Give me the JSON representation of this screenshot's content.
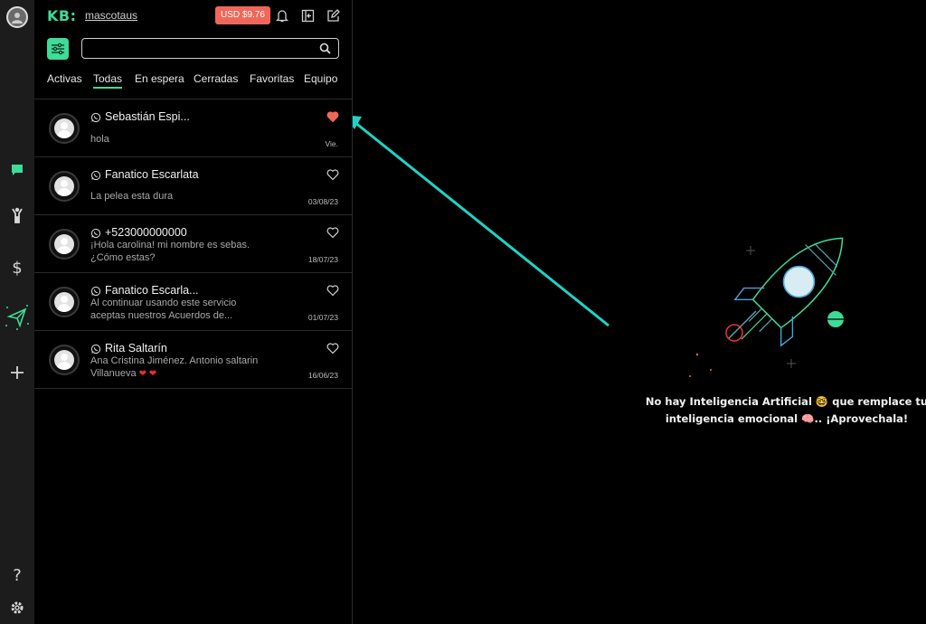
{
  "header": {
    "logo": "KB:",
    "username": "mascotaus",
    "balance": "USD $9.76"
  },
  "search": {
    "value": "",
    "placeholder": ""
  },
  "tabs": [
    {
      "label": "Activas"
    },
    {
      "label": "Todas",
      "active": true
    },
    {
      "label": "En espera"
    },
    {
      "label": "Cerradas"
    },
    {
      "label": "Favoritas"
    },
    {
      "label": "Equipo"
    }
  ],
  "conversations": [
    {
      "name": "Sebastián Espi...",
      "line1": "hola",
      "line2": "",
      "date": "Vie.",
      "favorite": true
    },
    {
      "name": "Fanatico Escarlata",
      "line1": "La pelea esta dura",
      "line2": "",
      "date": "03/08/23",
      "favorite": false
    },
    {
      "name": "+523000000000",
      "line1": "¡Hola carolina! mi nombre es sebas.",
      "line2": "¿Cómo estas?",
      "date": "18/07/23",
      "favorite": false
    },
    {
      "name": "Fanatico Escarla...",
      "line1": "Al continuar usando este servicio",
      "line2": "aceptas nuestros Acuerdos de...",
      "date": "01/07/23",
      "favorite": false
    },
    {
      "name": "Rita Saltarín",
      "line1": "Ana Cristina Jiménez. Antonio saltarin",
      "line2": "Villanueva",
      "date": "16/06/23",
      "favorite": false
    }
  ],
  "main": {
    "tagline_line1": "No hay Inteligencia Artificial 🤓 que remplace tu",
    "tagline_line2": "inteligencia emocional 🧠.. ¡Aprovechala!"
  },
  "colors": {
    "accent": "#3ddc97",
    "balance_bg": "#f0675a",
    "heart_red": "#f0675a",
    "arrow": "#1fd3c6",
    "rail_bg": "#1c1c1c"
  },
  "icons": [
    "user-avatar-icon",
    "chat-icon",
    "contacts-icon",
    "dollar-icon",
    "send-icon",
    "plus-icon",
    "help-icon",
    "settings-icon",
    "bell-icon",
    "logout-icon",
    "edit-icon",
    "filter-icon",
    "search-icon",
    "whatsapp-icon",
    "heart-icon",
    "rocket-illustration"
  ]
}
